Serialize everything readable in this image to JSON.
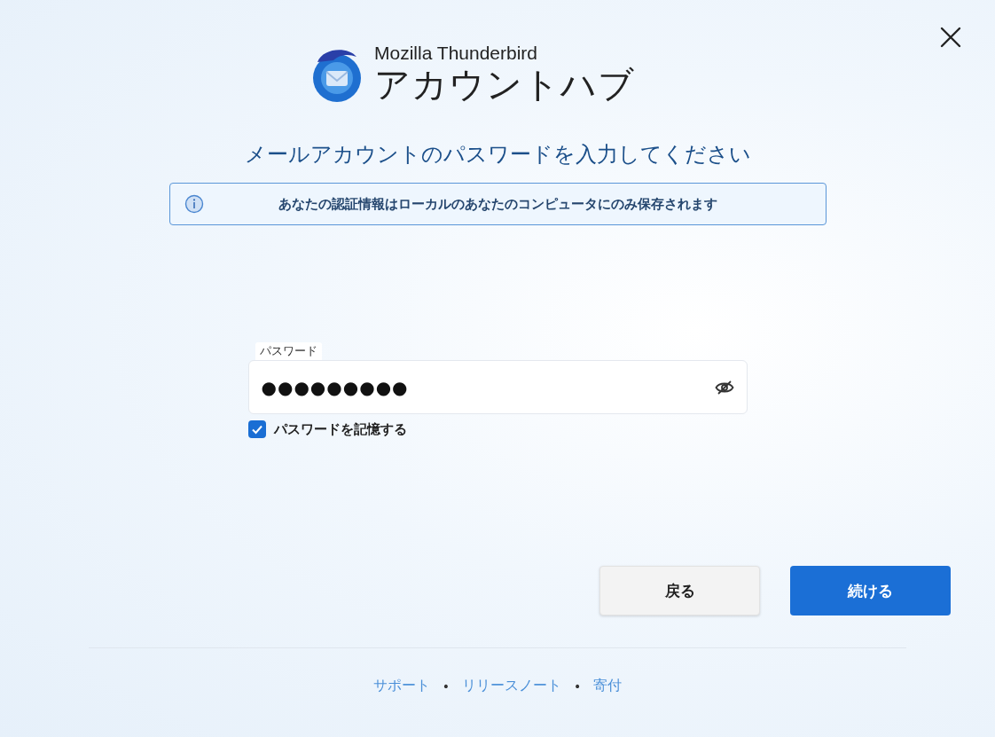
{
  "header": {
    "brand": "Mozilla Thunderbird",
    "title": "アカウントハブ"
  },
  "heading": "メールアカウントのパスワードを入力してください",
  "notice": "あなたの認証情報はローカルのあなたのコンピュータにのみ保存されます",
  "password_field": {
    "label": "パスワード",
    "value": "●●●●●●●●●"
  },
  "remember": {
    "label": "パスワードを記憶する",
    "checked": true
  },
  "buttons": [
    {
      "label": "戻る",
      "kind": "secondary"
    },
    {
      "label": "続ける",
      "kind": "primary"
    }
  ],
  "footer": [
    {
      "kind": "link",
      "text": "サポート"
    },
    {
      "kind": "separator",
      "text": "•"
    },
    {
      "kind": "link",
      "text": "リリースノート"
    },
    {
      "kind": "separator",
      "text": "•"
    },
    {
      "kind": "link",
      "text": "寄付"
    }
  ]
}
